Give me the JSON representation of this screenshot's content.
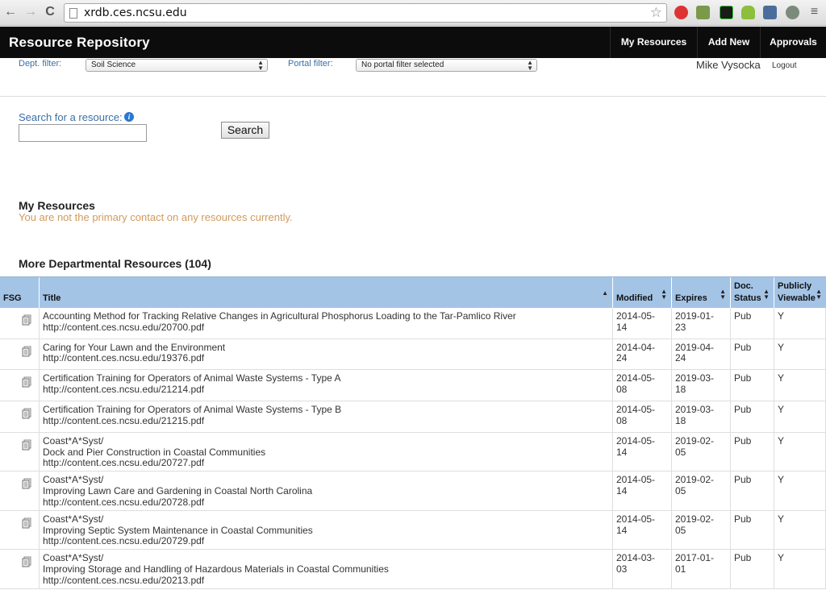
{
  "browser": {
    "url": "xrdb.ces.ncsu.edu",
    "back_icon": "←",
    "forward_icon": "→",
    "reload_icon": "C",
    "star_icon": "☆"
  },
  "header": {
    "title": "Resource Repository",
    "nav": [
      "My Resources",
      "Add New",
      "Approvals"
    ]
  },
  "filters": {
    "dept_label": "Dept. filter:",
    "dept_value": "Soil Science",
    "portal_label": "Portal filter:",
    "portal_value": "No portal filter selected"
  },
  "user": {
    "name": "Mike Vysocka",
    "logout": "Logout"
  },
  "search": {
    "label": "Search for a resource:",
    "info_icon": "i",
    "button": "Search",
    "value": ""
  },
  "my_resources": {
    "heading": "My Resources",
    "notice": "You are not the primary contact on any resources currently."
  },
  "departmental": {
    "heading": "More Departmental Resources (104)",
    "columns": {
      "fsg": "FSG",
      "title": "Title",
      "modified": "Modified",
      "expires": "Expires",
      "status": [
        "Doc.",
        "Status"
      ],
      "viewable": [
        "Publicly",
        "Viewable"
      ]
    },
    "rows": [
      {
        "title": [
          "Accounting Method for Tracking Relative Changes in Agricultural Phosphorus Loading to the Tar-Pamlico River",
          "http://content.ces.ncsu.edu/20700.pdf"
        ],
        "modified": [
          "2014-05-",
          "14"
        ],
        "expires": [
          "2019-01-",
          "23"
        ],
        "status": "Pub",
        "viewable": "Y"
      },
      {
        "title": [
          "Caring for Your Lawn and the Environment",
          "http://content.ces.ncsu.edu/19376.pdf"
        ],
        "modified": [
          "2014-04-",
          "24"
        ],
        "expires": [
          "2019-04-",
          "24"
        ],
        "status": "Pub",
        "viewable": "Y"
      },
      {
        "title": [
          "Certification Training for Operators of Animal Waste Systems - Type A",
          "http://content.ces.ncsu.edu/21214.pdf"
        ],
        "modified": [
          "2014-05-",
          "08"
        ],
        "expires": [
          "2019-03-",
          "18"
        ],
        "status": "Pub",
        "viewable": "Y"
      },
      {
        "title": [
          "Certification Training for Operators of Animal Waste Systems - Type B",
          "http://content.ces.ncsu.edu/21215.pdf"
        ],
        "modified": [
          "2014-05-",
          "08"
        ],
        "expires": [
          "2019-03-",
          "18"
        ],
        "status": "Pub",
        "viewable": "Y"
      },
      {
        "title": [
          "Coast*A*Syst/",
          "Dock and Pier Construction in Coastal Communities",
          "http://content.ces.ncsu.edu/20727.pdf"
        ],
        "modified": [
          "2014-05-",
          "14"
        ],
        "expires": [
          "2019-02-",
          "05"
        ],
        "status": "Pub",
        "viewable": "Y"
      },
      {
        "title": [
          "Coast*A*Syst/",
          "Improving Lawn Care and Gardening in Coastal North Carolina",
          "http://content.ces.ncsu.edu/20728.pdf"
        ],
        "modified": [
          "2014-05-",
          "14"
        ],
        "expires": [
          "2019-02-",
          "05"
        ],
        "status": "Pub",
        "viewable": "Y"
      },
      {
        "title": [
          "Coast*A*Syst/",
          "Improving Septic System Maintenance in Coastal Communities",
          "http://content.ces.ncsu.edu/20729.pdf"
        ],
        "modified": [
          "2014-05-",
          "14"
        ],
        "expires": [
          "2019-02-",
          "05"
        ],
        "status": "Pub",
        "viewable": "Y"
      },
      {
        "title": [
          "Coast*A*Syst/",
          "Improving Storage and Handling of Hazardous Materials in Coastal Communities",
          "http://content.ces.ncsu.edu/20213.pdf"
        ],
        "modified": [
          "2014-03-",
          "03"
        ],
        "expires": [
          "2017-01-",
          "01"
        ],
        "status": "Pub",
        "viewable": "Y"
      }
    ]
  }
}
